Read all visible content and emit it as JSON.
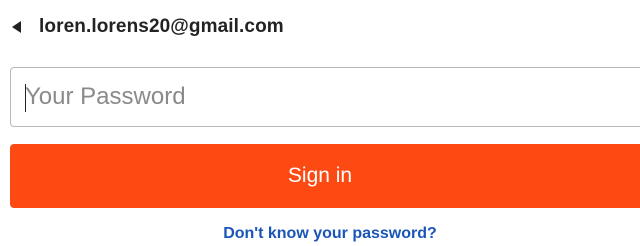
{
  "account": {
    "email": "loren.lorens20@gmail.com",
    "back_icon": "back-arrow-icon"
  },
  "password": {
    "placeholder": "Your Password",
    "value": ""
  },
  "sign_in": {
    "label": "Sign in",
    "color": "#fc4a12",
    "text_color": "#ffffff"
  },
  "forgot_password": {
    "label": "Don't know your password?",
    "color": "#1a55b8"
  }
}
